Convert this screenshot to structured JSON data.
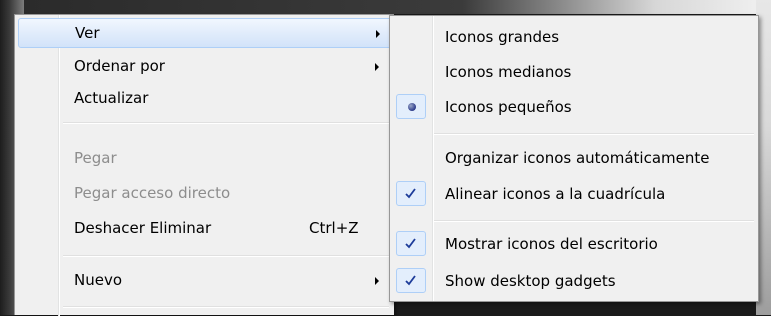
{
  "context_menu": {
    "items": [
      {
        "label": "Ver",
        "submenu": true,
        "hover": true
      },
      {
        "label": "Ordenar por",
        "submenu": true
      },
      {
        "label": "Actualizar"
      },
      {
        "label": "Pegar",
        "disabled": true
      },
      {
        "label": "Pegar acceso directo",
        "disabled": true
      },
      {
        "label": "Deshacer Eliminar",
        "shortcut": "Ctrl+Z"
      },
      {
        "label": "Nuevo",
        "submenu": true
      }
    ]
  },
  "view_submenu": {
    "items": [
      {
        "label": "Iconos grandes"
      },
      {
        "label": "Iconos medianos"
      },
      {
        "label": "Iconos pequeños",
        "state": "radio-selected"
      },
      {
        "label": "Organizar iconos automáticamente"
      },
      {
        "label": "Alinear iconos a la cuadrícula",
        "state": "checked"
      },
      {
        "label": "Mostrar iconos del escritorio",
        "state": "checked"
      },
      {
        "label": "Show desktop gadgets",
        "state": "checked"
      }
    ]
  },
  "colors": {
    "menu_bg": "#f0f0f0",
    "hover_border": "#aecff7",
    "check_color": "#1d3c9a"
  }
}
